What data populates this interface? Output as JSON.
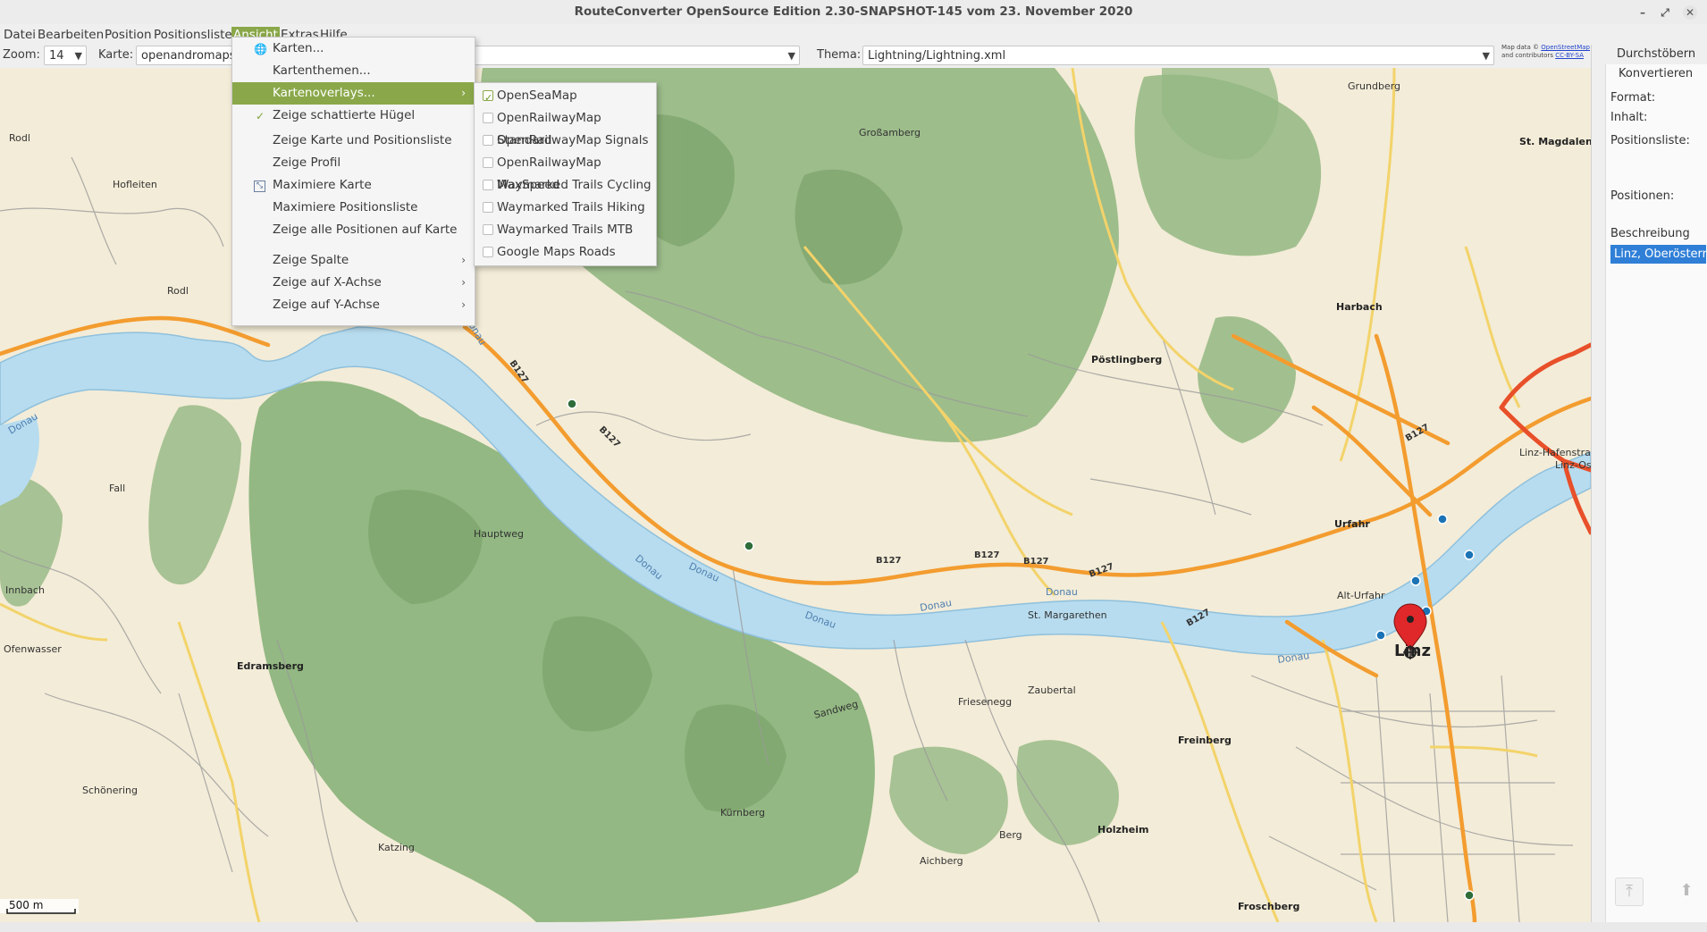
{
  "window": {
    "title": "RouteConverter OpenSource Edition 2.30-SNAPSHOT-145 vom 23. November 2020",
    "controls": [
      "minimize-icon",
      "restore-icon",
      "close-icon"
    ]
  },
  "menubar": {
    "items": [
      "Datei",
      "Bearbeiten",
      "Position",
      "Positionsliste",
      "Ansicht",
      "Extras",
      "Hilfe"
    ],
    "active": "Ansicht"
  },
  "toolbar": {
    "zoom_label": "Zoom:",
    "zoom_value": "14",
    "karte_label": "Karte:",
    "karte_value": "openandromaps",
    "thema_label": "Thema:",
    "thema_value": "Lightning/Lightning.xml",
    "attribution_line1": "Map data ©",
    "attribution_link1": "OpenStreetMap",
    "attribution_line2": "and contributors",
    "attribution_link2": "CC-BY-SA"
  },
  "ansicht_menu": {
    "items": [
      {
        "label": "Karten...",
        "icon": "globe-icon"
      },
      {
        "label": "Kartenthemen..."
      },
      {
        "label": "Kartenoverlays...",
        "submenu": true,
        "highlighted": true
      },
      {
        "label": "Zeige schattierte Hügel",
        "checked": true
      },
      {
        "label": "Zeige Karte und Positionsliste"
      },
      {
        "label": "Zeige Profil"
      },
      {
        "label": "Maximiere Karte",
        "icon": "maximize-icon"
      },
      {
        "label": "Maximiere Positionsliste"
      },
      {
        "label": "Zeige alle Positionen auf Karte"
      },
      {
        "label": "Zeige Spalte",
        "submenu": true
      },
      {
        "label": "Zeige auf X-Achse",
        "submenu": true
      },
      {
        "label": "Zeige auf Y-Achse",
        "submenu": true
      }
    ]
  },
  "overlay_submenu": {
    "items": [
      {
        "label": "OpenSeaMap",
        "checked": true
      },
      {
        "label": "OpenRailwayMap Standard",
        "checked": false
      },
      {
        "label": "OpenRailwayMap Signals",
        "checked": false
      },
      {
        "label": "OpenRailwayMap MaxSpeed",
        "checked": false
      },
      {
        "label": "Waymarked Trails Cycling",
        "checked": false
      },
      {
        "label": "Waymarked Trails Hiking",
        "checked": false
      },
      {
        "label": "Waymarked Trails MTB",
        "checked": false
      },
      {
        "label": "Google Maps Roads",
        "checked": false
      }
    ]
  },
  "right_panel": {
    "tab_browse": "Durchstöbern",
    "tab_convert": "Konvertieren",
    "format_label": "Format:",
    "inhalt_label": "Inhalt:",
    "positionsliste_label": "Positionsliste:",
    "positionen_label": "Positionen:",
    "beschreibung_header": "Beschreibung",
    "selected_row": "Linz, Oberösterr"
  },
  "map": {
    "scale_label": "500 m",
    "river_labels": [
      "Donau",
      "Donau",
      "Donau",
      "Donau",
      "Donau",
      "Donau",
      "Donau",
      "Donau"
    ],
    "road_labels": [
      "B127",
      "B127",
      "B127",
      "B127",
      "B127",
      "B127",
      "B127",
      "B127"
    ],
    "places": {
      "linz": "Linz",
      "urfahr": "Urfahr",
      "alt_urfahr": "Alt-Urfahr",
      "postlingberg": "Pöstlingberg",
      "harbach": "Harbach",
      "grundberg": "Grundberg",
      "st_magdalena": "St. Magdalena",
      "edramsberg": "Edramsberg",
      "freinberg": "Freinberg",
      "holzheim": "Holzheim",
      "froschberg": "Froschberg",
      "st_margarethen": "St. Margarethen",
      "grossamberg": "Großamberg",
      "zaubertal": "Zaubertal",
      "friesenegg": "Friesenegg",
      "linz_hafen": "Linz-Hafenstraße",
      "linz_ost": "Linz-Ost",
      "rodl": "Rodl",
      "rodl2": "Rodl",
      "hofleiten": "Hofleiten",
      "fall": "Fall",
      "innbach": "Innbach",
      "ofenwasser": "Ofenwasser",
      "katzing": "Katzing",
      "schonering": "Schönering",
      "aichberg": "Aichberg",
      "berg": "Berg",
      "hauptweg": "Hauptweg",
      "sandweg": "Sandweg",
      "kurnberg": "Kürnberg"
    },
    "colors": {
      "forest": "#8db27a",
      "forest_dark": "#6f9a5e",
      "land": "#f3ecd8",
      "water": "#b7dcef",
      "primary_road": "#f39c2f",
      "motorway": "#e8502a",
      "minor_road": "#8a8a8a",
      "marker": "#e0282a"
    }
  }
}
